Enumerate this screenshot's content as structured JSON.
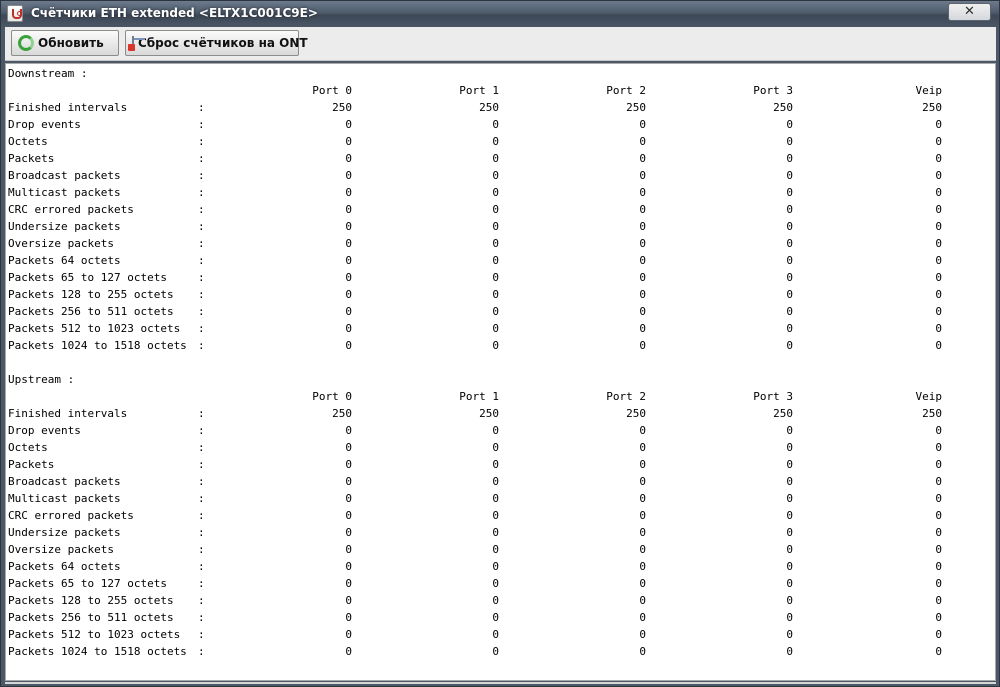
{
  "window": {
    "title": "Счётчики ETH extended <ELTX1C001C9E>",
    "close_glyph": "✕"
  },
  "toolbar": {
    "refresh_label": "Обновить",
    "reset_label": "Сброс счётчиков на ONT"
  },
  "downstream": {
    "title": "Downstream :",
    "headers": [
      "Port 0",
      "Port 1",
      "Port 2",
      "Port 3",
      "Veip"
    ],
    "rows": [
      {
        "label": "Finished intervals",
        "colon": ":",
        "values": [
          "250",
          "250",
          "250",
          "250",
          "250"
        ]
      },
      {
        "label": "Drop events",
        "colon": ":",
        "values": [
          "0",
          "0",
          "0",
          "0",
          "0"
        ]
      },
      {
        "label": "Octets",
        "colon": ":",
        "values": [
          "0",
          "0",
          "0",
          "0",
          "0"
        ]
      },
      {
        "label": "Packets",
        "colon": ":",
        "values": [
          "0",
          "0",
          "0",
          "0",
          "0"
        ]
      },
      {
        "label": "Broadcast packets",
        "colon": ":",
        "values": [
          "0",
          "0",
          "0",
          "0",
          "0"
        ]
      },
      {
        "label": "Multicast packets",
        "colon": ":",
        "values": [
          "0",
          "0",
          "0",
          "0",
          "0"
        ]
      },
      {
        "label": "CRC errored packets",
        "colon": ":",
        "values": [
          "0",
          "0",
          "0",
          "0",
          "0"
        ]
      },
      {
        "label": "Undersize packets",
        "colon": ":",
        "values": [
          "0",
          "0",
          "0",
          "0",
          "0"
        ]
      },
      {
        "label": "Oversize packets",
        "colon": ":",
        "values": [
          "0",
          "0",
          "0",
          "0",
          "0"
        ]
      },
      {
        "label": "Packets 64 octets",
        "colon": ":",
        "values": [
          "0",
          "0",
          "0",
          "0",
          "0"
        ]
      },
      {
        "label": "Packets 65 to 127 octets",
        "colon": ":",
        "values": [
          "0",
          "0",
          "0",
          "0",
          "0"
        ]
      },
      {
        "label": "Packets 128 to 255 octets",
        "colon": ":",
        "values": [
          "0",
          "0",
          "0",
          "0",
          "0"
        ]
      },
      {
        "label": "Packets 256 to 511 octets",
        "colon": ":",
        "values": [
          "0",
          "0",
          "0",
          "0",
          "0"
        ]
      },
      {
        "label": "Packets 512 to 1023 octets",
        "colon": ":",
        "values": [
          "0",
          "0",
          "0",
          "0",
          "0"
        ]
      },
      {
        "label": "Packets 1024 to 1518 octets",
        "colon": ":",
        "values": [
          "0",
          "0",
          "0",
          "0",
          "0"
        ]
      }
    ]
  },
  "upstream": {
    "title": "Upstream :",
    "headers": [
      "Port 0",
      "Port 1",
      "Port 2",
      "Port 3",
      "Veip"
    ],
    "rows": [
      {
        "label": "Finished intervals",
        "colon": ":",
        "values": [
          "250",
          "250",
          "250",
          "250",
          "250"
        ]
      },
      {
        "label": "Drop events",
        "colon": ":",
        "values": [
          "0",
          "0",
          "0",
          "0",
          "0"
        ]
      },
      {
        "label": "Octets",
        "colon": ":",
        "values": [
          "0",
          "0",
          "0",
          "0",
          "0"
        ]
      },
      {
        "label": "Packets",
        "colon": ":",
        "values": [
          "0",
          "0",
          "0",
          "0",
          "0"
        ]
      },
      {
        "label": "Broadcast packets",
        "colon": ":",
        "values": [
          "0",
          "0",
          "0",
          "0",
          "0"
        ]
      },
      {
        "label": "Multicast packets",
        "colon": ":",
        "values": [
          "0",
          "0",
          "0",
          "0",
          "0"
        ]
      },
      {
        "label": "CRC errored packets",
        "colon": ":",
        "values": [
          "0",
          "0",
          "0",
          "0",
          "0"
        ]
      },
      {
        "label": "Undersize packets",
        "colon": ":",
        "values": [
          "0",
          "0",
          "0",
          "0",
          "0"
        ]
      },
      {
        "label": "Oversize packets",
        "colon": ":",
        "values": [
          "0",
          "0",
          "0",
          "0",
          "0"
        ]
      },
      {
        "label": "Packets 64 octets",
        "colon": ":",
        "values": [
          "0",
          "0",
          "0",
          "0",
          "0"
        ]
      },
      {
        "label": "Packets 65 to 127 octets",
        "colon": ":",
        "values": [
          "0",
          "0",
          "0",
          "0",
          "0"
        ]
      },
      {
        "label": "Packets 128 to 255 octets",
        "colon": ":",
        "values": [
          "0",
          "0",
          "0",
          "0",
          "0"
        ]
      },
      {
        "label": "Packets 256 to 511 octets",
        "colon": ":",
        "values": [
          "0",
          "0",
          "0",
          "0",
          "0"
        ]
      },
      {
        "label": "Packets 512 to 1023 octets",
        "colon": ":",
        "values": [
          "0",
          "0",
          "0",
          "0",
          "0"
        ]
      },
      {
        "label": "Packets 1024 to 1518 octets",
        "colon": ":",
        "values": [
          "0",
          "0",
          "0",
          "0",
          "0"
        ]
      }
    ]
  }
}
